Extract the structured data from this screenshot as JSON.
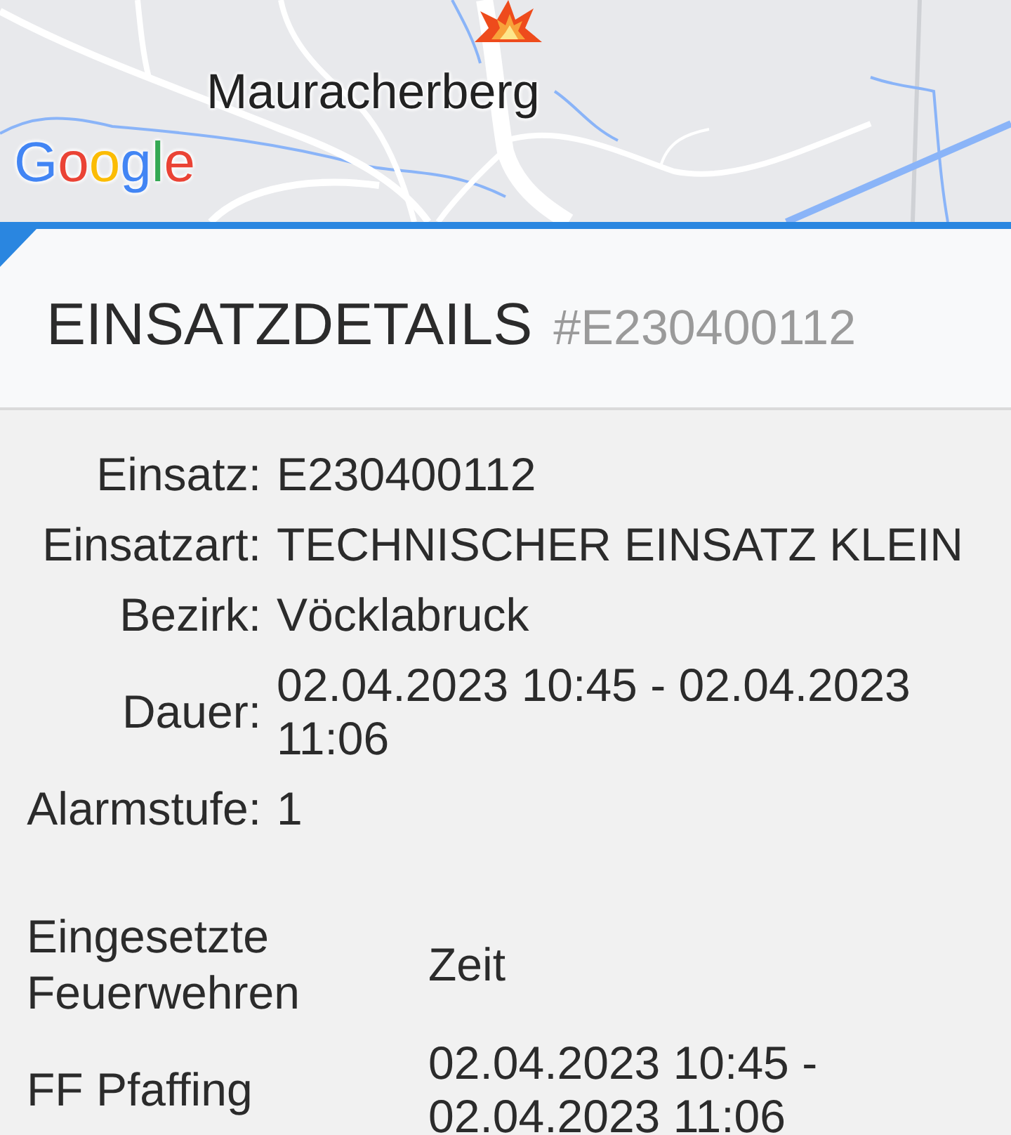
{
  "map": {
    "place_label": "Mauracherberg",
    "logo": "Google"
  },
  "header": {
    "title": "EINSATZDETAILS",
    "id": "#E230400112"
  },
  "details": [
    {
      "label": "Einsatz:",
      "value": "E230400112"
    },
    {
      "label": "Einsatzart:",
      "value": "TECHNISCHER EINSATZ KLEIN"
    },
    {
      "label": "Bezirk:",
      "value": "Vöcklabruck"
    },
    {
      "label": "Dauer:",
      "value": "02.04.2023 10:45 - 02.04.2023 11:06"
    },
    {
      "label": "Alarmstufe:",
      "value": "1"
    }
  ],
  "brigades_table": {
    "columns": [
      "Eingesetzte Feuerwehren",
      "Zeit"
    ],
    "rows": [
      {
        "name": "FF Pfaffing",
        "time": "02.04.2023 10:45 - 02.04.2023 11:06"
      }
    ]
  }
}
